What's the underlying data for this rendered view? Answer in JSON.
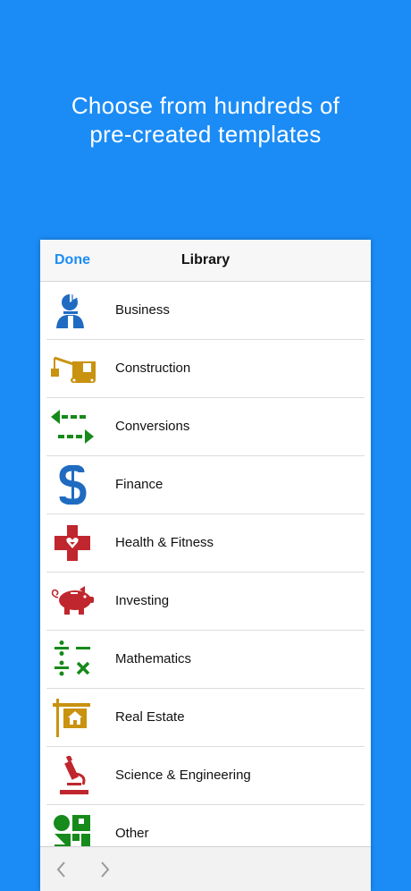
{
  "headline": {
    "line1": "Choose from hundreds of",
    "line2": "pre-created templates"
  },
  "navbar": {
    "done_label": "Done",
    "title": "Library"
  },
  "library": {
    "items": [
      {
        "label": "Business",
        "icon": "business-person-chart-icon",
        "color": "#1f6bc1"
      },
      {
        "label": "Construction",
        "icon": "crane-truck-icon",
        "color": "#c9920f"
      },
      {
        "label": "Conversions",
        "icon": "arrows-left-right-icon",
        "color": "#168a1a"
      },
      {
        "label": "Finance",
        "icon": "dollar-sign-icon",
        "color": "#1f6bc1"
      },
      {
        "label": "Health & Fitness",
        "icon": "medical-cross-heart-icon",
        "color": "#c0262d"
      },
      {
        "label": "Investing",
        "icon": "piggy-bank-icon",
        "color": "#c0262d"
      },
      {
        "label": "Mathematics",
        "icon": "math-operators-icon",
        "color": "#168a1a"
      },
      {
        "label": "Real Estate",
        "icon": "house-sign-icon",
        "color": "#c9920f"
      },
      {
        "label": "Science & Engineering",
        "icon": "microscope-icon",
        "color": "#c0262d"
      },
      {
        "label": "Other",
        "icon": "shapes-icon",
        "color": "#168a1a"
      }
    ]
  },
  "toolbar": {
    "back_icon": "chevron-left-icon",
    "forward_icon": "chevron-right-icon"
  }
}
